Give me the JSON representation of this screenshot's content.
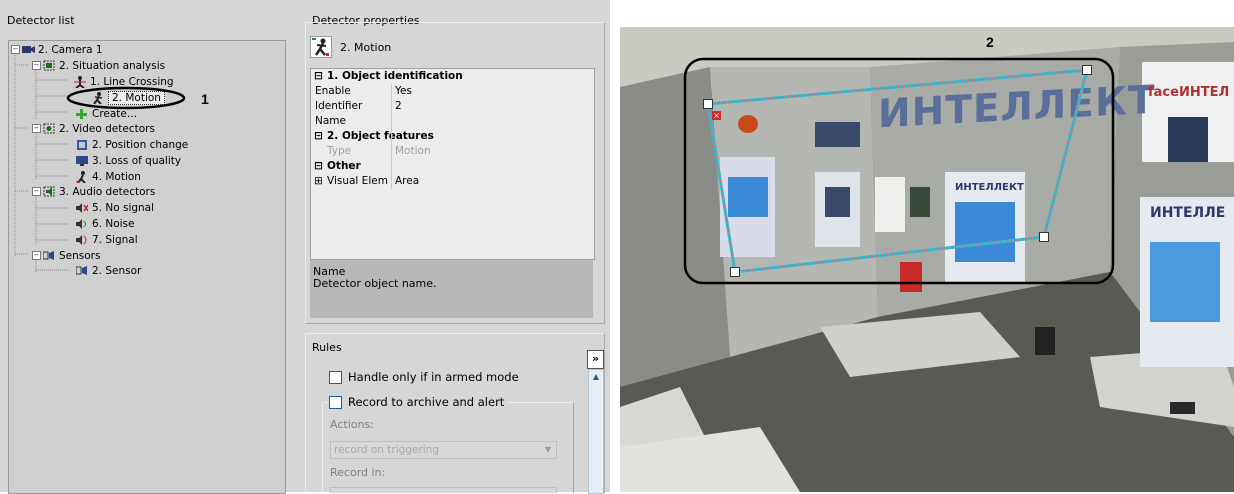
{
  "detector_list": {
    "title": "Detector list",
    "items": [
      {
        "label": "2. Camera 1",
        "icon": "camera-icon"
      },
      {
        "label": "2. Situation analysis",
        "icon": "situation-analysis-icon"
      },
      {
        "label": "1. Line Crossing",
        "icon": "line-crossing-icon"
      },
      {
        "label": "2. Motion",
        "icon": "motion-icon",
        "selected": true
      },
      {
        "label": "Create...",
        "icon": "plus-icon"
      },
      {
        "label": "2. Video detectors",
        "icon": "video-detectors-icon"
      },
      {
        "label": "2. Position change",
        "icon": "position-change-icon"
      },
      {
        "label": "3. Loss of quality",
        "icon": "loss-of-quality-icon"
      },
      {
        "label": "4. Motion",
        "icon": "motion-icon"
      },
      {
        "label": "3. Audio detectors",
        "icon": "audio-detectors-icon"
      },
      {
        "label": "5. No signal",
        "icon": "no-signal-icon"
      },
      {
        "label": "6. Noise",
        "icon": "noise-icon"
      },
      {
        "label": "7. Signal",
        "icon": "signal-icon"
      },
      {
        "label": "Sensors",
        "icon": "sensors-icon"
      },
      {
        "label": "2. Sensor",
        "icon": "sensor-icon"
      }
    ],
    "callout": "1"
  },
  "detector_properties": {
    "title": "Detector properties",
    "detector_name": "2. Motion",
    "grid": {
      "cat1": "1. Object identification",
      "enable_label": "Enable",
      "enable_value": "Yes",
      "identifier_label": "Identifier",
      "identifier_value": "2",
      "name_label": "Name",
      "name_value": "",
      "cat2": "2. Object features",
      "type_label": "Type",
      "type_value": "Motion",
      "cat3": "Other",
      "visual_label": "Visual Elem",
      "visual_value": "Area"
    },
    "description": {
      "title": "Name",
      "text": "Detector object name."
    }
  },
  "rules": {
    "title": "Rules",
    "expand_label": "»",
    "armed_label": "Handle only if in armed mode",
    "record_label": "Record to archive and alert",
    "actions_label": "Actions:",
    "actions_value": "record on triggering",
    "record_in_label": "Record in:"
  },
  "video": {
    "callout": "2",
    "wall_text_main": "ИНТЕЛЛЕКТ",
    "wall_text_right": "faceИНТЕЛ",
    "poster_text": "ИНТЕЛЛЕКТ",
    "poster_text_right": "ИНТЕЛЛЕ",
    "zone_color": "#2bbfd8",
    "zone_dash_color": "#ff5a5a"
  }
}
